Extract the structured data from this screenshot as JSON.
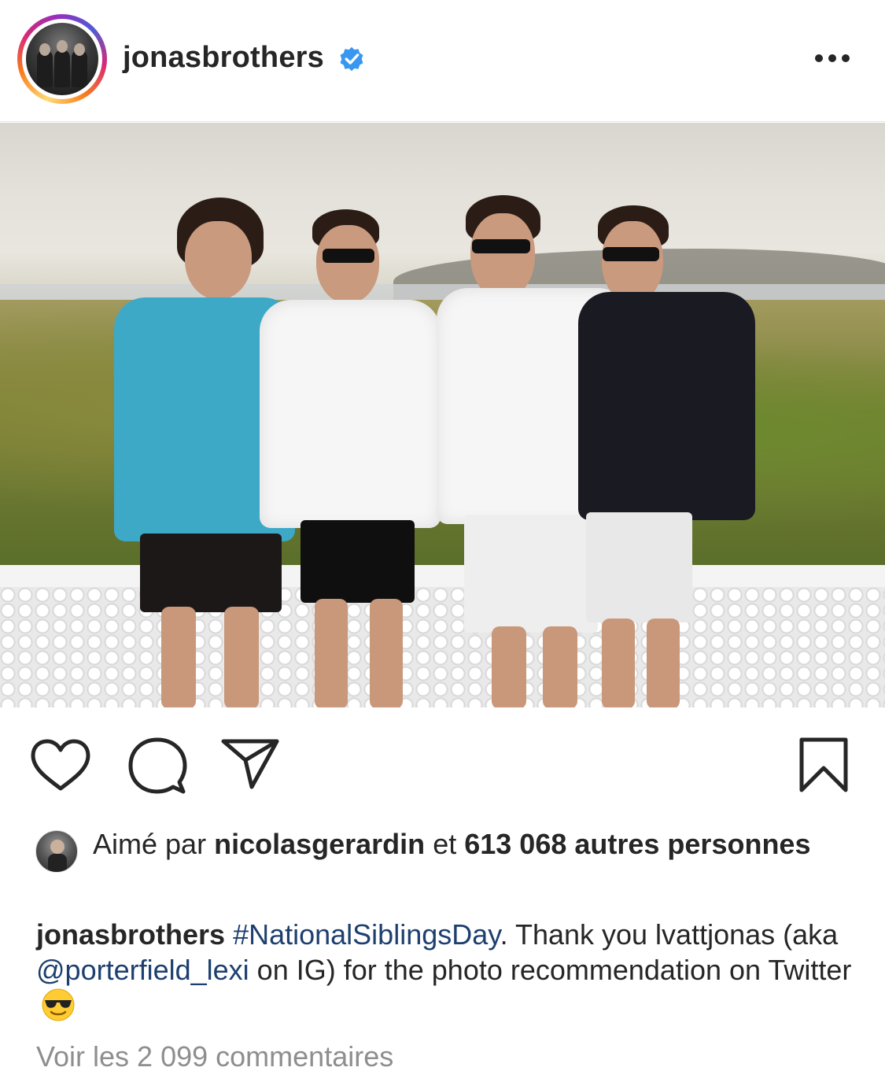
{
  "post": {
    "username": "jonasbrothers",
    "verified": true
  },
  "likes": {
    "prefix": "Aimé par",
    "user": "nicolasgerardin",
    "middle": "et",
    "count": "613 068 autres personnes"
  },
  "caption": {
    "username": "jonasbrothers",
    "hashtag": "#NationalSiblingsDay",
    "text1": ". Thank you lvattjonas (aka ",
    "mention": "@porterfield_lexi",
    "text2": " on IG) for the photo recommendation on Twitter"
  },
  "comments_link": "Voir les 2 099 commentaires",
  "colors": {
    "verified_blue": "#3897f0",
    "link_blue": "#1d3f6f",
    "text": "#262626",
    "muted": "#8e8e8e"
  },
  "icons": [
    "more-icon",
    "heart-icon",
    "comment-icon",
    "share-icon",
    "bookmark-icon",
    "verified-icon",
    "sunglasses-emoji"
  ]
}
